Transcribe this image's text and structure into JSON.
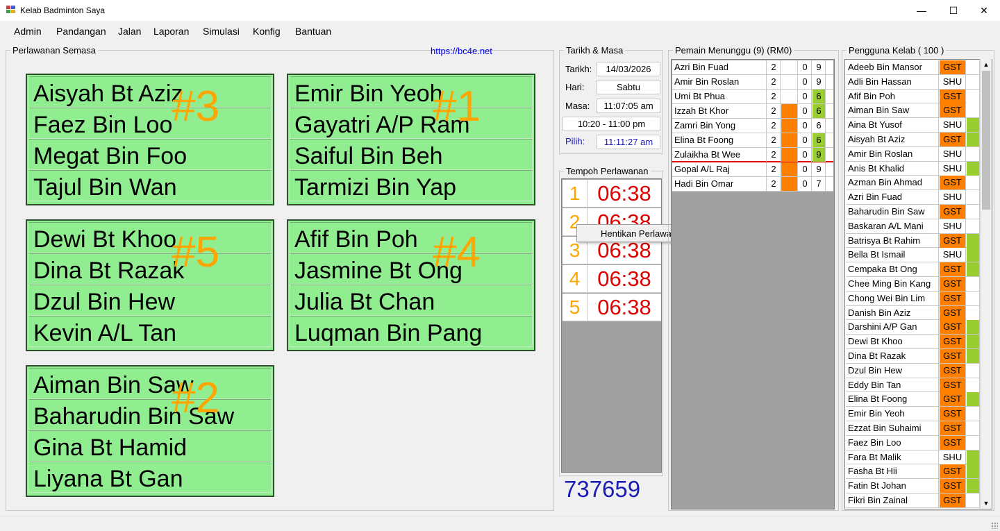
{
  "window": {
    "title": "Kelab Badminton Saya"
  },
  "menu": [
    "Admin",
    "Pandangan",
    "Jalan",
    "Laporan",
    "Simulasi",
    "Konfig",
    "Bantuan"
  ],
  "current_matches": {
    "label": "Perlawanan Semasa",
    "url": "https://bc4e.net",
    "courts": [
      {
        "number": "#3",
        "players": [
          "Aisyah Bt Aziz",
          "Faez Bin Loo",
          "Megat Bin Foo",
          "Tajul Bin Wan"
        ]
      },
      {
        "number": "#1",
        "players": [
          "Emir Bin Yeoh",
          "Gayatri A/P Ram",
          "Saiful Bin Beh",
          "Tarmizi Bin Yap"
        ]
      },
      {
        "number": "#5",
        "players": [
          "Dewi Bt Khoo",
          "Dina Bt Razak",
          "Dzul Bin Hew",
          "Kevin A/L Tan"
        ]
      },
      {
        "number": "#4",
        "players": [
          "Afif Bin Poh",
          "Jasmine Bt Ong",
          "Julia Bt Chan",
          "Luqman Bin Pang"
        ]
      },
      {
        "number": "#2",
        "players": [
          "Aiman Bin Saw",
          "Baharudin Bin Saw",
          "Gina Bt Hamid",
          "Liyana Bt Gan"
        ]
      }
    ]
  },
  "datetime": {
    "label": "Tarikh & Masa",
    "date_label": "Tarikh:",
    "date": "14/03/2026",
    "day_label": "Hari:",
    "day": "Sabtu",
    "time_label": "Masa:",
    "time": "11:07:05 am",
    "session": "10:20 - 11:00 pm",
    "pick_label": "Pilih:",
    "pick_time": "11:11:27 am"
  },
  "match_timer": {
    "label": "Tempoh Perlawanan",
    "rows": [
      {
        "index": "1",
        "time": "06:38"
      },
      {
        "index": "2",
        "time": "06:38"
      },
      {
        "index": "3",
        "time": "06:38"
      },
      {
        "index": "4",
        "time": "06:38"
      },
      {
        "index": "5",
        "time": "06:38"
      }
    ]
  },
  "context_menu": {
    "item": "Hentikan Perlawanan"
  },
  "counter": "737659",
  "waiting": {
    "label": "Pemain Menunggu (9) (RM0)",
    "rows": [
      {
        "name": "Azri Bin Fuad",
        "a": "2",
        "b": "0",
        "c": "9",
        "b_color": "#ffffff",
        "c_color": "#ffffff"
      },
      {
        "name": "Amir Bin Roslan",
        "a": "2",
        "b": "0",
        "c": "9",
        "b_color": "#ffffff",
        "c_color": "#ffffff"
      },
      {
        "name": "Umi Bt Phua",
        "a": "2",
        "b": "0",
        "c": "6",
        "b_color": "#ffffff",
        "c_color": "#9acd32"
      },
      {
        "name": "Izzah Bt Khor",
        "a": "2",
        "b": "0",
        "c": "6",
        "b_color": "#ff7f00",
        "c_color": "#9acd32"
      },
      {
        "name": "Zamri Bin Yong",
        "a": "2",
        "b": "0",
        "c": "6",
        "b_color": "#ff7f00",
        "c_color": "#ffffff"
      },
      {
        "name": "Elina Bt Foong",
        "a": "2",
        "b": "0",
        "c": "6",
        "b_color": "#ff7f00",
        "c_color": "#9acd32"
      },
      {
        "name": "Zulaikha Bt Wee",
        "a": "2",
        "b": "0",
        "c": "9",
        "b_color": "#ff7f00",
        "c_color": "#9acd32"
      },
      {
        "name": "Gopal A/L Raj",
        "a": "2",
        "b": "0",
        "c": "9",
        "b_color": "#ff7f00",
        "c_color": "#ffffff"
      },
      {
        "name": "Hadi Bin Omar",
        "a": "2",
        "b": "0",
        "c": "7",
        "b_color": "#ff7f00",
        "c_color": "#ffffff"
      }
    ]
  },
  "members": {
    "label": "Pengguna Kelab ( 100 )",
    "rows": [
      {
        "name": "Adeeb Bin Mansor",
        "type": "GST",
        "type_color": "#ff7f00",
        "flag_color": "#ffffff"
      },
      {
        "name": "Adli Bin Hassan",
        "type": "SHU",
        "type_color": "#ffffff",
        "flag_color": "#ffffff"
      },
      {
        "name": "Afif Bin Poh",
        "type": "GST",
        "type_color": "#ff7f00",
        "flag_color": "#ffffff"
      },
      {
        "name": "Aiman Bin Saw",
        "type": "GST",
        "type_color": "#ff7f00",
        "flag_color": "#ffffff"
      },
      {
        "name": "Aina Bt Yusof",
        "type": "SHU",
        "type_color": "#ffffff",
        "flag_color": "#9acd32"
      },
      {
        "name": "Aisyah Bt Aziz",
        "type": "GST",
        "type_color": "#ff7f00",
        "flag_color": "#9acd32"
      },
      {
        "name": "Amir Bin Roslan",
        "type": "SHU",
        "type_color": "#ffffff",
        "flag_color": "#ffffff"
      },
      {
        "name": "Anis Bt Khalid",
        "type": "SHU",
        "type_color": "#ffffff",
        "flag_color": "#9acd32"
      },
      {
        "name": "Azman Bin Ahmad",
        "type": "GST",
        "type_color": "#ff7f00",
        "flag_color": "#ffffff"
      },
      {
        "name": "Azri Bin Fuad",
        "type": "SHU",
        "type_color": "#ffffff",
        "flag_color": "#ffffff"
      },
      {
        "name": "Baharudin Bin Saw",
        "type": "GST",
        "type_color": "#ff7f00",
        "flag_color": "#ffffff"
      },
      {
        "name": "Baskaran A/L Mani",
        "type": "SHU",
        "type_color": "#ffffff",
        "flag_color": "#ffffff"
      },
      {
        "name": "Batrisya Bt Rahim",
        "type": "GST",
        "type_color": "#ff7f00",
        "flag_color": "#9acd32"
      },
      {
        "name": "Bella Bt Ismail",
        "type": "SHU",
        "type_color": "#ffffff",
        "flag_color": "#9acd32"
      },
      {
        "name": "Cempaka Bt Ong",
        "type": "GST",
        "type_color": "#ff7f00",
        "flag_color": "#9acd32"
      },
      {
        "name": "Chee Ming Bin Kang",
        "type": "GST",
        "type_color": "#ff7f00",
        "flag_color": "#ffffff"
      },
      {
        "name": "Chong Wei Bin Lim",
        "type": "GST",
        "type_color": "#ff7f00",
        "flag_color": "#ffffff"
      },
      {
        "name": "Danish Bin Aziz",
        "type": "GST",
        "type_color": "#ff7f00",
        "flag_color": "#ffffff"
      },
      {
        "name": "Darshini A/P Gan",
        "type": "GST",
        "type_color": "#ff7f00",
        "flag_color": "#9acd32"
      },
      {
        "name": "Dewi Bt Khoo",
        "type": "GST",
        "type_color": "#ff7f00",
        "flag_color": "#9acd32"
      },
      {
        "name": "Dina Bt Razak",
        "type": "GST",
        "type_color": "#ff7f00",
        "flag_color": "#9acd32"
      },
      {
        "name": "Dzul Bin Hew",
        "type": "GST",
        "type_color": "#ff7f00",
        "flag_color": "#ffffff"
      },
      {
        "name": "Eddy Bin Tan",
        "type": "GST",
        "type_color": "#ff7f00",
        "flag_color": "#ffffff"
      },
      {
        "name": "Elina Bt Foong",
        "type": "GST",
        "type_color": "#ff7f00",
        "flag_color": "#9acd32"
      },
      {
        "name": "Emir Bin Yeoh",
        "type": "GST",
        "type_color": "#ff7f00",
        "flag_color": "#ffffff"
      },
      {
        "name": "Ezzat Bin Suhaimi",
        "type": "GST",
        "type_color": "#ff7f00",
        "flag_color": "#ffffff"
      },
      {
        "name": "Faez Bin Loo",
        "type": "GST",
        "type_color": "#ff7f00",
        "flag_color": "#ffffff"
      },
      {
        "name": "Fara Bt Malik",
        "type": "SHU",
        "type_color": "#ffffff",
        "flag_color": "#9acd32"
      },
      {
        "name": "Fasha Bt Hii",
        "type": "GST",
        "type_color": "#ff7f00",
        "flag_color": "#9acd32"
      },
      {
        "name": "Fatin Bt Johan",
        "type": "GST",
        "type_color": "#ff7f00",
        "flag_color": "#9acd32"
      },
      {
        "name": "Fikri Bin Zainal",
        "type": "GST",
        "type_color": "#ff7f00",
        "flag_color": "#ffffff"
      }
    ]
  },
  "colors": {
    "court_fill": "#90ee90",
    "court_number": "#ffa500",
    "timer_text": "#e00000",
    "counter_text": "#1a1ab4",
    "orange": "#ff7f00",
    "lime": "#9acd32"
  }
}
